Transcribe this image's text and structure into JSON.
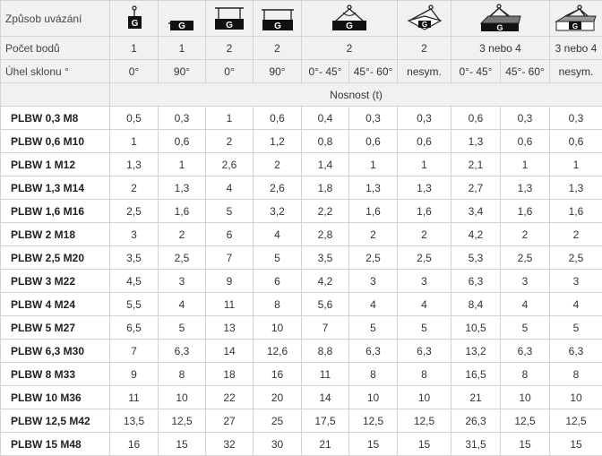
{
  "header": {
    "method_label": "Způsob uvázání",
    "points_label": "Počet bodů",
    "angle_label": "Úhel sklonu °",
    "capacity_label": "Nosnost (t)",
    "icon_letter": "G",
    "icons": [
      "single-point-vertical-lift-icon",
      "single-point-horizontal-lift-icon",
      "two-point-vertical-lift-icon",
      "two-point-horizontal-lift-icon",
      "two-leg-sling-icon",
      "two-leg-asymmetric-sling-icon",
      "three-four-leg-sling-icon",
      "three-four-leg-asymmetric-sling-icon"
    ],
    "points": [
      "1",
      "1",
      "2",
      "2",
      "2",
      "2",
      "3 nebo 4",
      "3 nebo 4"
    ],
    "angles": [
      "0°",
      "90°",
      "0°",
      "90°",
      "0°- 45°",
      "45°- 60°",
      "nesym.",
      "0°- 45°",
      "45°- 60°",
      "nesym."
    ]
  },
  "rows": [
    {
      "model": "PLBW 0,3 M8",
      "v": [
        "0,5",
        "0,3",
        "1",
        "0,6",
        "0,4",
        "0,3",
        "0,3",
        "0,6",
        "0,3",
        "0,3"
      ]
    },
    {
      "model": "PLBW 0,6 M10",
      "v": [
        "1",
        "0,6",
        "2",
        "1,2",
        "0,8",
        "0,6",
        "0,6",
        "1,3",
        "0,6",
        "0,6"
      ]
    },
    {
      "model": "PLBW 1 M12",
      "v": [
        "1,3",
        "1",
        "2,6",
        "2",
        "1,4",
        "1",
        "1",
        "2,1",
        "1",
        "1"
      ]
    },
    {
      "model": "PLBW 1,3 M14",
      "v": [
        "2",
        "1,3",
        "4",
        "2,6",
        "1,8",
        "1,3",
        "1,3",
        "2,7",
        "1,3",
        "1,3"
      ]
    },
    {
      "model": "PLBW 1,6 M16",
      "v": [
        "2,5",
        "1,6",
        "5",
        "3,2",
        "2,2",
        "1,6",
        "1,6",
        "3,4",
        "1,6",
        "1,6"
      ]
    },
    {
      "model": "PLBW 2 M18",
      "v": [
        "3",
        "2",
        "6",
        "4",
        "2,8",
        "2",
        "2",
        "4,2",
        "2",
        "2"
      ]
    },
    {
      "model": "PLBW 2,5 M20",
      "v": [
        "3,5",
        "2,5",
        "7",
        "5",
        "3,5",
        "2,5",
        "2,5",
        "5,3",
        "2,5",
        "2,5"
      ]
    },
    {
      "model": "PLBW 3 M22",
      "v": [
        "4,5",
        "3",
        "9",
        "6",
        "4,2",
        "3",
        "3",
        "6,3",
        "3",
        "3"
      ]
    },
    {
      "model": "PLBW 4 M24",
      "v": [
        "5,5",
        "4",
        "11",
        "8",
        "5,6",
        "4",
        "4",
        "8,4",
        "4",
        "4"
      ]
    },
    {
      "model": "PLBW 5 M27",
      "v": [
        "6,5",
        "5",
        "13",
        "10",
        "7",
        "5",
        "5",
        "10,5",
        "5",
        "5"
      ]
    },
    {
      "model": "PLBW 6,3 M30",
      "v": [
        "7",
        "6,3",
        "14",
        "12,6",
        "8,8",
        "6,3",
        "6,3",
        "13,2",
        "6,3",
        "6,3"
      ]
    },
    {
      "model": "PLBW 8 M33",
      "v": [
        "9",
        "8",
        "18",
        "16",
        "11",
        "8",
        "8",
        "16,5",
        "8",
        "8"
      ]
    },
    {
      "model": "PLBW 10 M36",
      "v": [
        "11",
        "10",
        "22",
        "20",
        "14",
        "10",
        "10",
        "21",
        "10",
        "10"
      ]
    },
    {
      "model": "PLBW 12,5 M42",
      "v": [
        "13,5",
        "12,5",
        "27",
        "25",
        "17,5",
        "12,5",
        "12,5",
        "26,3",
        "12,5",
        "12,5"
      ]
    },
    {
      "model": "PLBW 15 M48",
      "v": [
        "16",
        "15",
        "32",
        "30",
        "21",
        "15",
        "15",
        "31,5",
        "15",
        "15"
      ]
    }
  ]
}
